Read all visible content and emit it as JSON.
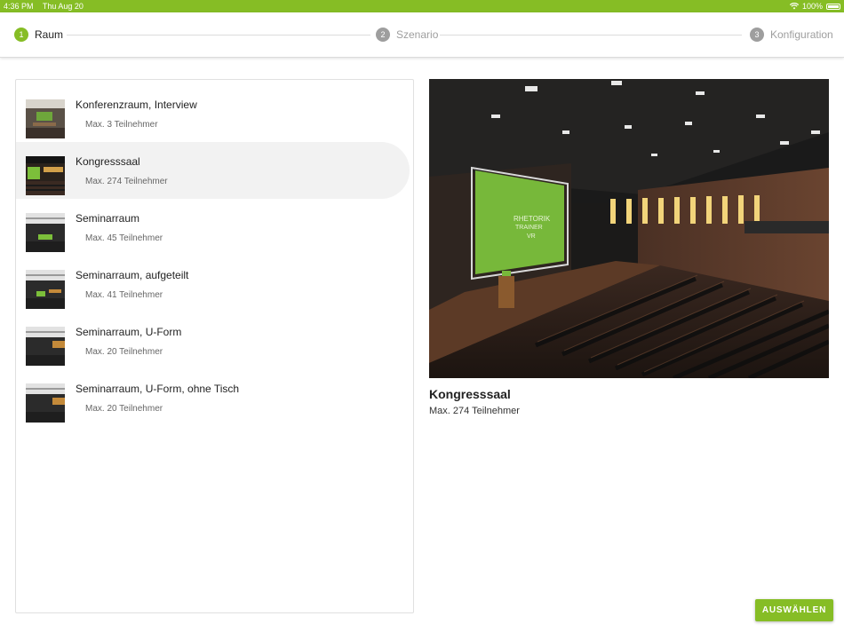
{
  "status_bar": {
    "time": "4:36 PM",
    "date": "Thu Aug 20",
    "battery": "100%"
  },
  "stepper": {
    "steps": [
      {
        "number": "1",
        "label": "Raum",
        "active": true
      },
      {
        "number": "2",
        "label": "Szenario",
        "active": false
      },
      {
        "number": "3",
        "label": "Konfiguration",
        "active": false
      }
    ]
  },
  "rooms": [
    {
      "name": "Konferenzraum, Interview",
      "capacity": "Max. 3 Teilnehmer"
    },
    {
      "name": "Kongresssaal",
      "capacity": "Max. 274 Teilnehmer",
      "selected": true
    },
    {
      "name": "Seminarraum",
      "capacity": "Max. 45 Teilnehmer"
    },
    {
      "name": "Seminarraum, aufgeteilt",
      "capacity": "Max. 41 Teilnehmer"
    },
    {
      "name": "Seminarraum, U-Form",
      "capacity": "Max. 20 Teilnehmer"
    },
    {
      "name": "Seminarraum, U-Form, ohne Tisch",
      "capacity": "Max. 20 Teilnehmer"
    }
  ],
  "preview": {
    "title": "Kongresssaal",
    "capacity": "Max. 274 Teilnehmer",
    "screen_text": [
      "RHETORIK",
      "TRAINER",
      "VR"
    ]
  },
  "actions": {
    "select_label": "AUSWÄHLEN"
  },
  "colors": {
    "accent": "#86bd25",
    "inactive": "#9e9e9e"
  }
}
